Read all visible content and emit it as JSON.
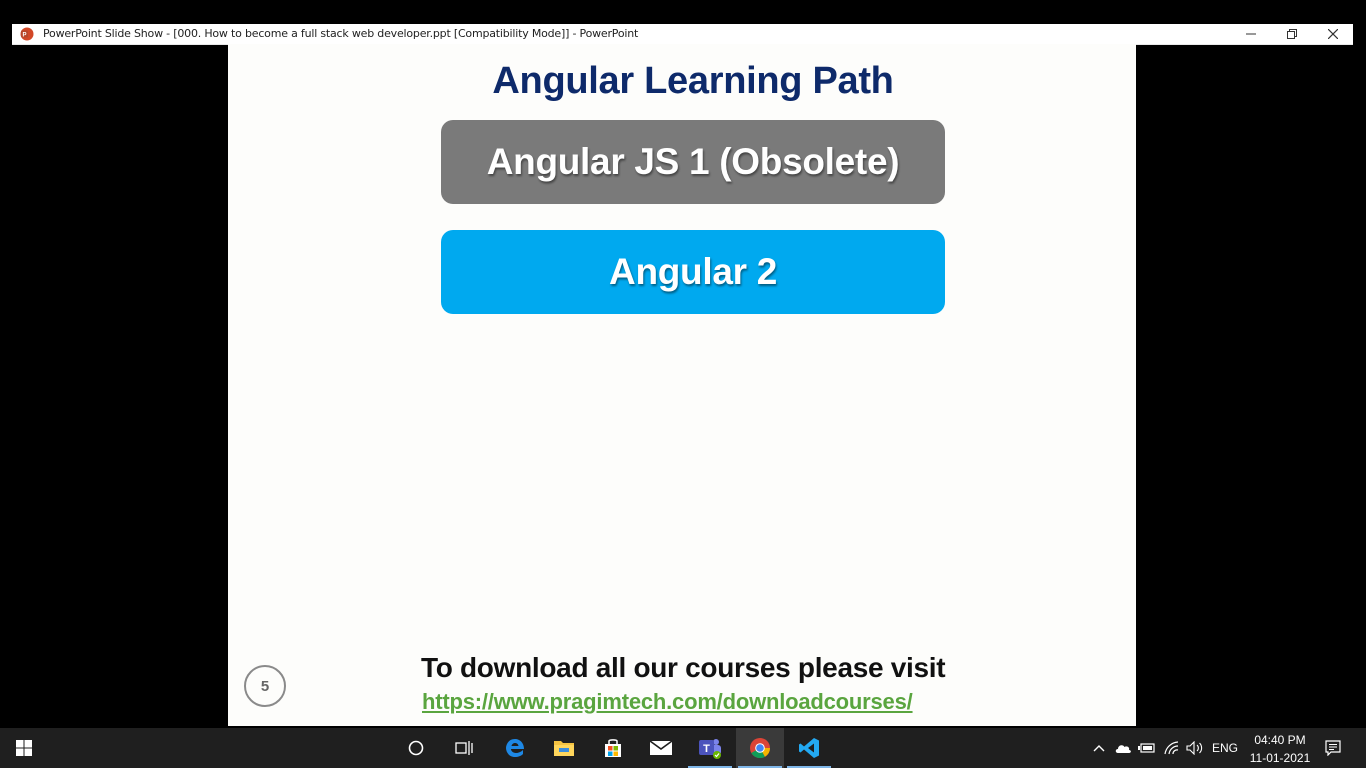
{
  "window": {
    "title": "PowerPoint Slide Show - [000. How to become a full stack web developer.ppt [Compatibility Mode]] - PowerPoint",
    "controls": [
      "minimize-icon",
      "restore-icon",
      "close-icon"
    ]
  },
  "slide": {
    "title": "Angular Learning Path",
    "items": [
      {
        "label": "Angular JS 1 (Obsolete)",
        "color": "#7a7a7a"
      },
      {
        "label": "Angular 2",
        "color": "#00a9ef"
      }
    ],
    "number": "5",
    "footer_text": "To download all our courses please visit",
    "footer_link": "https://www.pragimtech.com/downloadcourses/",
    "colors": {
      "title": "#0e2a6a",
      "link": "#5aa53f"
    }
  },
  "taskbar": {
    "apps": [
      "start-icon",
      "search-circle-icon",
      "task-view-icon",
      "edge-icon",
      "file-explorer-icon",
      "store-icon",
      "mail-icon",
      "teams-icon",
      "chrome-icon",
      "vscode-icon"
    ],
    "language": "ENG",
    "time": "04:40 PM",
    "date": "11-01-2021"
  }
}
